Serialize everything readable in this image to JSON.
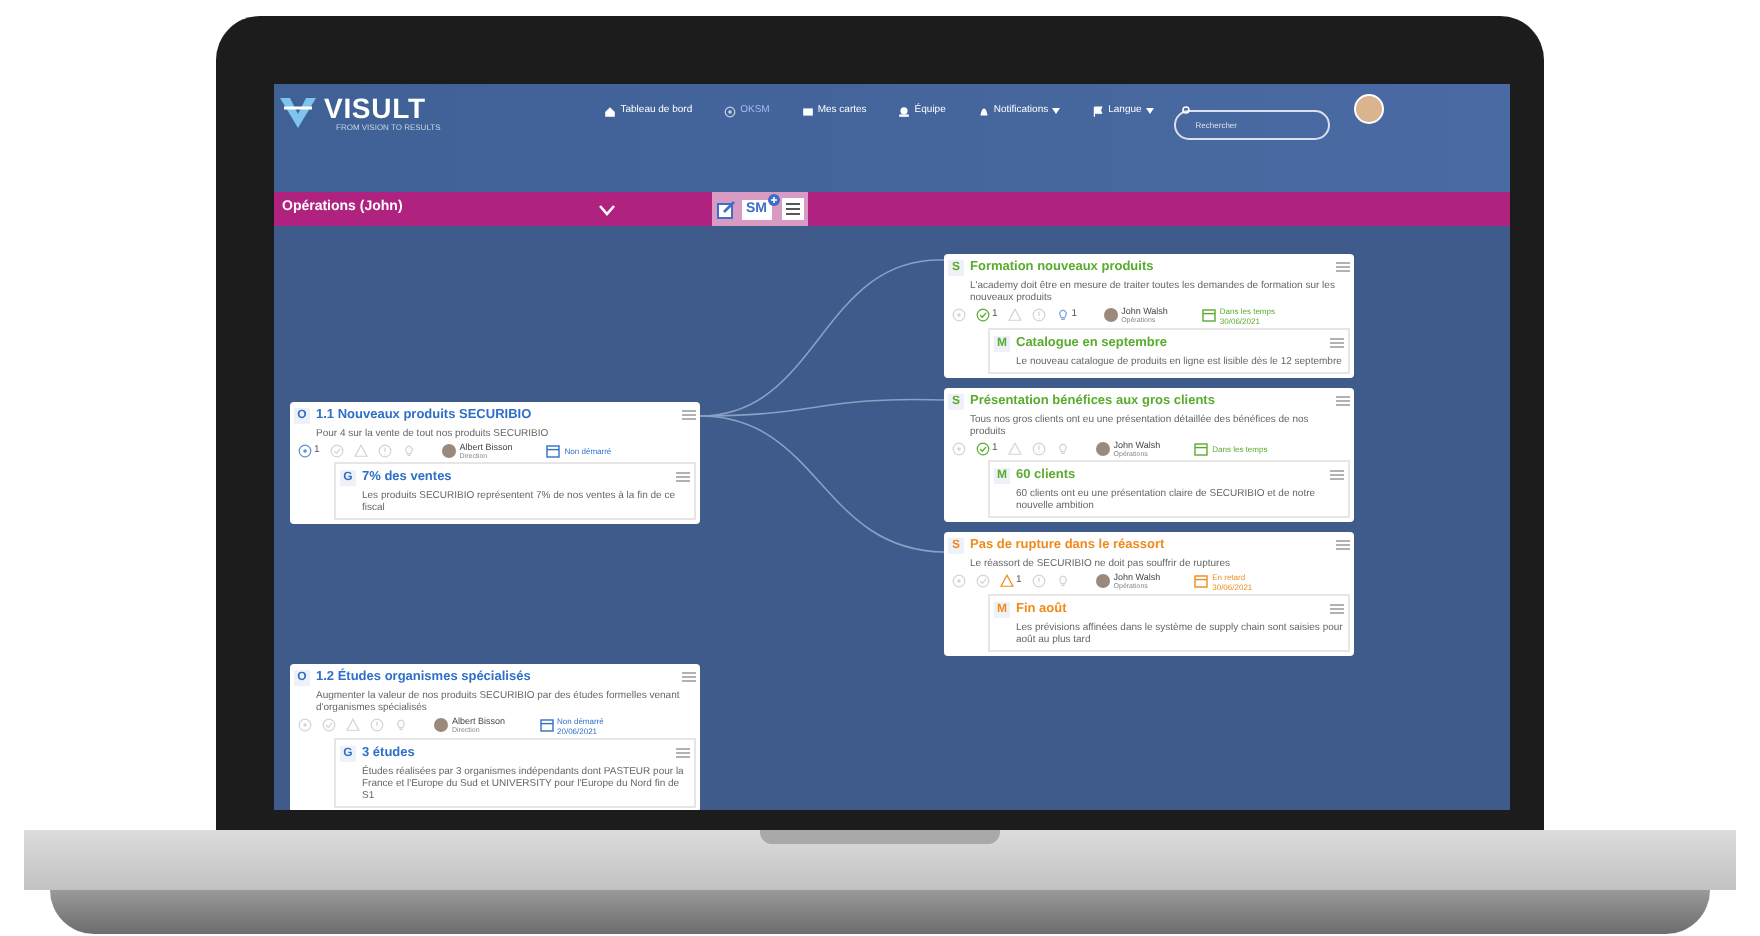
{
  "app": {
    "logo": "VISULT",
    "tagline": "FROM VISION TO RESULTS"
  },
  "nav": [
    {
      "label": "Tableau de bord",
      "kind": "home",
      "selected": false
    },
    {
      "label": "OKSM",
      "kind": "target",
      "selected": true
    },
    {
      "label": "Mes cartes",
      "kind": "card",
      "selected": false
    },
    {
      "label": "Équipe",
      "kind": "team",
      "selected": false
    },
    {
      "label": "Notifications",
      "kind": "bell",
      "selected": false,
      "dropdown": true
    },
    {
      "label": "Langue",
      "kind": "flag",
      "selected": false,
      "dropdown": true
    }
  ],
  "search": {
    "placeholder": "Rechercher"
  },
  "title_bar": {
    "title": "Opérations (John)",
    "toolbar_label": "SM"
  },
  "nodes": [
    {
      "code": "O",
      "title": "1.1 Nouveaux produits SECURIBIO",
      "color": "#2f6fc8",
      "description": "Pour 4 sur la vente de tout nos produits SECURIBIO",
      "indicators": [
        {
          "kind": "target",
          "count": "1"
        },
        {
          "kind": "check"
        },
        {
          "kind": "warning"
        },
        {
          "kind": "alert"
        },
        {
          "kind": "idea"
        }
      ],
      "owner": "Albert Bisson",
      "role": "Direction",
      "status": "Non démarré",
      "child": {
        "code": "G",
        "title": "7% des ventes",
        "description": "Les produits SECURIBIO représentent 7% de nos ventes à la fin de ce fiscal"
      }
    },
    {
      "code": "O",
      "title": "1.2 Études organismes spécialisés",
      "color": "#2f6fc8",
      "description": "Augmenter la valeur de nos produits SECURIBIO par des études formelles venant d'organismes spécialisés",
      "indicators": [
        {
          "kind": "target"
        },
        {
          "kind": "check"
        },
        {
          "kind": "warning"
        },
        {
          "kind": "alert"
        },
        {
          "kind": "idea"
        }
      ],
      "owner": "Albert Bisson",
      "role": "Direction",
      "status": "Non démarré",
      "date": "20/06/2021",
      "child": {
        "code": "G",
        "title": "3 études",
        "description": "Études réalisées par 3 organismes indépendants dont PASTEUR pour la France et l'Europe du Sud et UNIVERSITY pour l'Europe du Nord fin de S1"
      }
    },
    {
      "code": "S",
      "title": "Formation nouveaux produits",
      "color": "#5aab2e",
      "description": "L'academy doit être en mesure de traiter toutes les demandes de formation sur les nouveaux produits",
      "indicators": [
        {
          "kind": "target"
        },
        {
          "kind": "check",
          "count": "1"
        },
        {
          "kind": "warning"
        },
        {
          "kind": "alert"
        },
        {
          "kind": "idea",
          "count": "1"
        }
      ],
      "owner": "John Walsh",
      "role": "Opérations",
      "status": "Dans les temps",
      "date": "30/06/2021",
      "child": {
        "code": "M",
        "title": "Catalogue en septembre",
        "description": "Le nouveau catalogue de produits en ligne est lisible dès le 12 septembre"
      }
    },
    {
      "code": "S",
      "title": "Présentation bénéfices aux gros clients",
      "color": "#5aab2e",
      "description": "Tous nos gros clients ont eu une présentation détaillée des bénéfices de nos produits",
      "indicators": [
        {
          "kind": "target"
        },
        {
          "kind": "check",
          "count": "1"
        },
        {
          "kind": "warning"
        },
        {
          "kind": "alert"
        },
        {
          "kind": "idea"
        }
      ],
      "owner": "John Walsh",
      "role": "Opérations",
      "status": "Dans les temps",
      "child": {
        "code": "M",
        "title": "60 clients",
        "description": "60 clients ont eu une présentation claire de SECURIBIO et de notre nouvelle ambition"
      }
    },
    {
      "code": "S",
      "title": "Pas de rupture dans le réassort",
      "color": "#f08a1c",
      "description": "Le réassort de SECURIBIO ne doit pas souffrir de ruptures",
      "indicators": [
        {
          "kind": "target"
        },
        {
          "kind": "check"
        },
        {
          "kind": "warning",
          "count": "1"
        },
        {
          "kind": "alert"
        },
        {
          "kind": "idea"
        }
      ],
      "owner": "John Walsh",
      "role": "Opérations",
      "status": "En retard",
      "date": "30/06/2021",
      "child": {
        "code": "M",
        "title": "Fin août",
        "description": "Les prévisions affinées dans le système de supply chain sont saisies pour août au plus tard"
      }
    }
  ]
}
